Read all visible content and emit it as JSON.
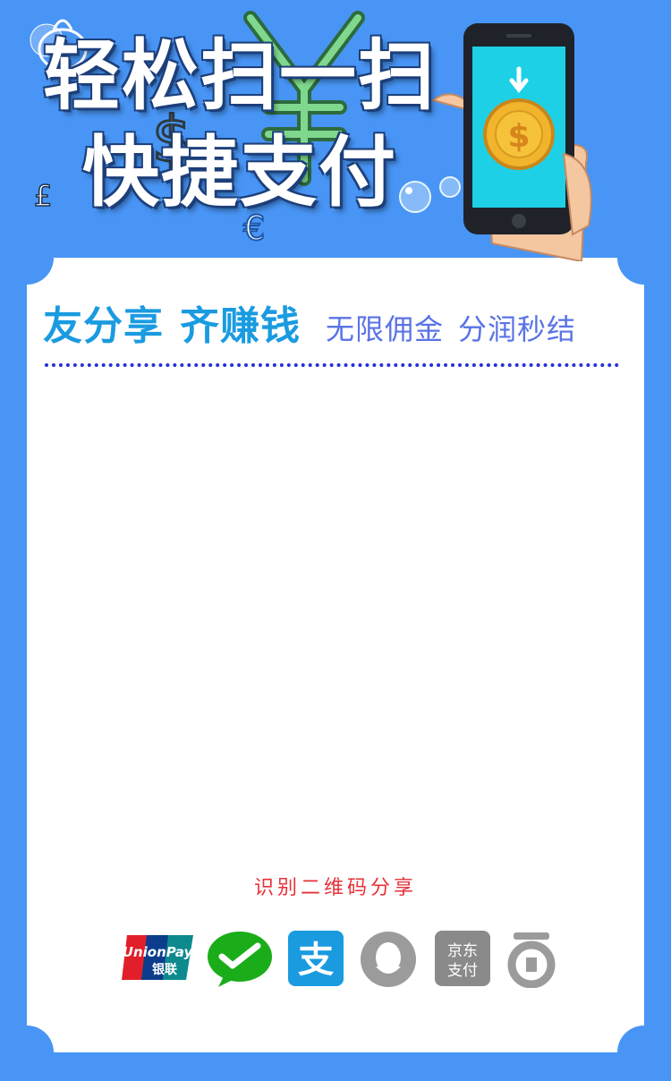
{
  "hero": {
    "title_line1": "轻松扫一扫",
    "title_line2": "快捷支付"
  },
  "card": {
    "slogan_part1": "友分享",
    "slogan_part2": "齐赚钱",
    "slogan_part3": "无限佣金",
    "slogan_part4": "分润秒结",
    "scan_label": "识别二维码分享"
  },
  "payments": {
    "unionpay_line1": "UnionPay",
    "unionpay_line2": "银联",
    "alipay_glyph": "支",
    "jd_line1": "京东",
    "jd_line2": "支付"
  },
  "colors": {
    "background": "#4895f5",
    "slogan_blue": "#1a9be0",
    "slogan_purple": "#5a73e6",
    "scan_red": "#e53238"
  }
}
